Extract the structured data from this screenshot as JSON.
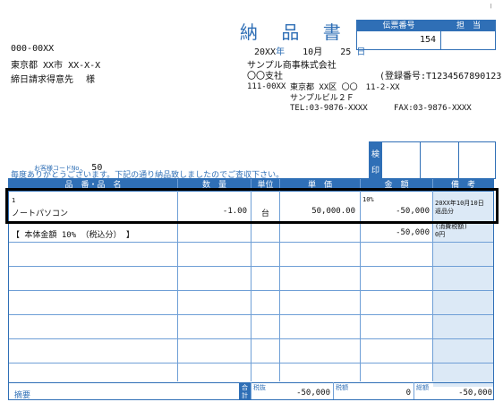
{
  "document": {
    "title": "納 品 書",
    "date": {
      "year": "20XX",
      "year_unit": "年",
      "month": "10月",
      "day": "25",
      "day_unit": "日"
    },
    "slip": {
      "number_label": "伝票番号",
      "person_label": "担　当",
      "number": "154"
    }
  },
  "customer": {
    "postal": "000-00XX",
    "address": "東京都 XX市 XX-X-X",
    "name": "締日請求得意先",
    "honorific": "様",
    "code_label": "お客様コードNo.",
    "code": "50",
    "message": "毎度ありがとうございます。下記の通り納品致しましたのでご査収下さい。"
  },
  "issuer": {
    "company": "サンプル商事株式会社",
    "branch": "〇〇支社",
    "registration": "(登録番号:T1234567890123)",
    "postal": "111-00XX",
    "address1": "東京都 XX区 〇〇　11-2-XX",
    "address2": "サンプルビル２Ｆ",
    "tel": "TEL:03-9876-XXXX",
    "fax": "FAX:03-9876-XXXX"
  },
  "stamp": {
    "label1": "検",
    "label2": "印"
  },
  "table": {
    "columns": [
      "品　番・品　名",
      "数　量",
      "単位",
      "単　価",
      "金　額",
      "備　考"
    ],
    "rows": [
      {
        "code": "1",
        "name": "ノートパソコン",
        "qty": "-1.00",
        "unit": "台",
        "price": "50,000.00",
        "tax": "10%",
        "amount": "-50,000",
        "note1": "20XX年10月10日",
        "note2": "返品分"
      },
      {
        "name": "【 本体金額 10% （税込分） 】",
        "amount": "-50,000",
        "note1": "(消費税額)",
        "note2": "0円"
      }
    ]
  },
  "footer": {
    "remarks_label": "摘要",
    "total_label1": "合",
    "total_label2": "計",
    "subtotal_label": "税抜",
    "subtotal": "-50,000",
    "tax_label": "税額",
    "tax": "0",
    "total_label": "総額",
    "total": "-50,000"
  },
  "colors": {
    "accent": "#2f6fb6",
    "shade": "#dce9f6",
    "highlight_border": "#000000"
  }
}
